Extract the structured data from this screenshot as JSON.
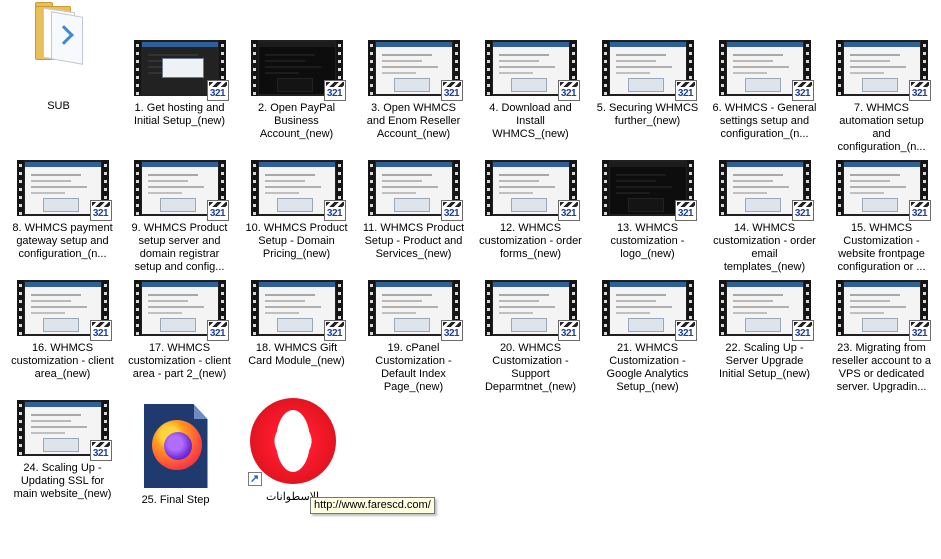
{
  "folder": {
    "label": "SUB",
    "icon": "folder-icon"
  },
  "videos": [
    {
      "label": "1. Get hosting and Initial Setup_(new)",
      "frame": "mid"
    },
    {
      "label": "2. Open PayPal Business Account_(new)",
      "frame": "dark"
    },
    {
      "label": "3. Open WHMCS and Enom Reseller Account_(new)",
      "frame": "light"
    },
    {
      "label": "4. Download and Install WHMCS_(new)",
      "frame": "light"
    },
    {
      "label": "5. Securing WHMCS further_(new)",
      "frame": "light"
    },
    {
      "label": "6. WHMCS - General settings setup and configuration_(n...",
      "frame": "light"
    },
    {
      "label": "7. WHMCS automation setup and configuration_(n...",
      "frame": "light"
    },
    {
      "label": "8. WHMCS payment gateway setup and configuration_(n...",
      "frame": "light"
    },
    {
      "label": "9. WHMCS Product setup server and domain registrar setup and config...",
      "frame": "light"
    },
    {
      "label": "10. WHMCS Product Setup - Domain Pricing_(new)",
      "frame": "light"
    },
    {
      "label": "11. WHMCS Product Setup - Product and Services_(new)",
      "frame": "light"
    },
    {
      "label": "12. WHMCS customization - order forms_(new)",
      "frame": "light"
    },
    {
      "label": "13. WHMCS customization - logo_(new)",
      "frame": "dark"
    },
    {
      "label": "14. WHMCS customization - order email templates_(new)",
      "frame": "light"
    },
    {
      "label": "15. WHMCS Customization - website frontpage configuration or ...",
      "frame": "light"
    },
    {
      "label": "16. WHMCS customization - client area_(new)",
      "frame": "light"
    },
    {
      "label": "17. WHMCS customization - client area - part 2_(new)",
      "frame": "light"
    },
    {
      "label": "18. WHMCS Gift Card Module_(new)",
      "frame": "light"
    },
    {
      "label": "19. cPanel Customization - Default Index Page_(new)",
      "frame": "light"
    },
    {
      "label": "20. WHMCS Customization - Support Deparmtnet_(new)",
      "frame": "light"
    },
    {
      "label": "21. WHMCS Customization - Google Analytics Setup_(new)",
      "frame": "light"
    },
    {
      "label": "22. Scaling Up - Server Upgrade Initial Setup_(new)",
      "frame": "light"
    },
    {
      "label": "23. Migrating from reseller account to a VPS or dedicated server. Upgradin...",
      "frame": "light"
    },
    {
      "label": "24. Scaling Up - Updating SSL for main website_(new)",
      "frame": "light"
    }
  ],
  "player_badge": {
    "text": "321",
    "icon": "media-player-321-icon"
  },
  "final_step": {
    "label": "25. Final Step",
    "icon": "firefox-file-icon"
  },
  "opera_shortcut": {
    "label": "الاسطوانات",
    "icon": "opera-icon",
    "overlay_icon": "shortcut-arrow-icon"
  },
  "tooltip": {
    "text": "http://www.farescd.com/"
  }
}
